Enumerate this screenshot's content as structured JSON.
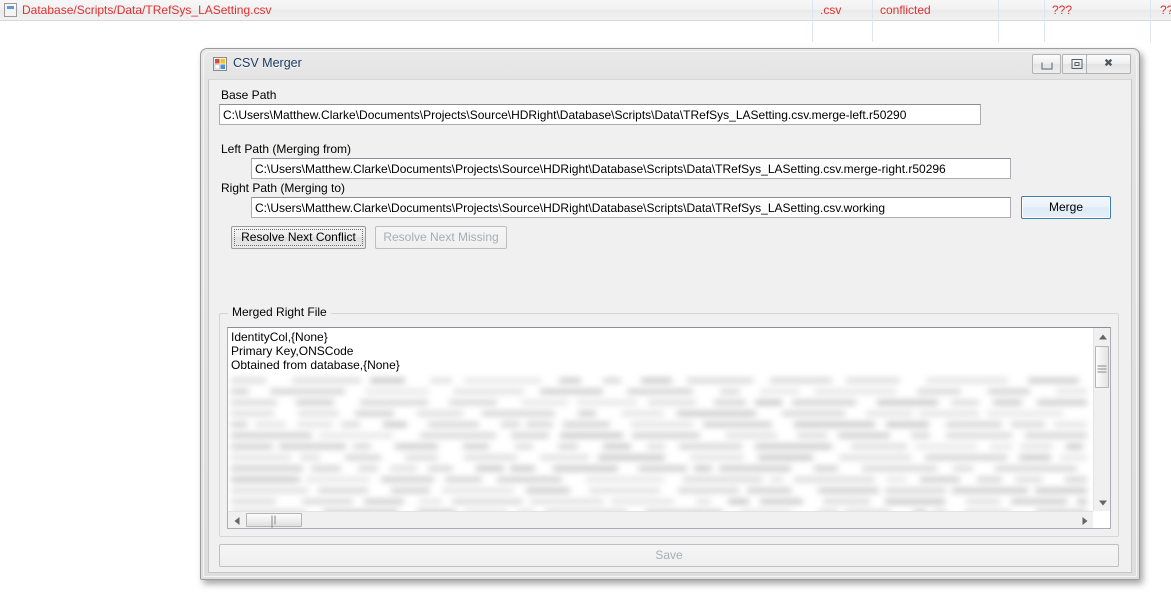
{
  "backdrop": {
    "row": {
      "icon": "csv-file-icon",
      "path": "Database/Scripts/Data/TRefSys_LASetting.csv",
      "extension": ".csv",
      "status": "conflicted",
      "property_status": "???",
      "lock_status": "??",
      "text_color": "#e03030"
    }
  },
  "window": {
    "title": "CSV Merger",
    "icon": "windows-forms-app-icon",
    "controls": {
      "minimize": "minimize-icon",
      "maximize": "restore-icon",
      "close": "✖"
    }
  },
  "form": {
    "base_path": {
      "label": "Base Path",
      "value": "C:\\Users\\Matthew.Clarke\\Documents\\Projects\\Source\\HDRight\\Database\\Scripts\\Data\\TRefSys_LASetting.csv.merge-left.r50290"
    },
    "left_path": {
      "label": "Left Path (Merging from)",
      "value": "C:\\Users\\Matthew.Clarke\\Documents\\Projects\\Source\\HDRight\\Database\\Scripts\\Data\\TRefSys_LASetting.csv.merge-right.r50296"
    },
    "right_path": {
      "label": "Right Path (Merging to)",
      "value": "C:\\Users\\Matthew.Clarke\\Documents\\Projects\\Source\\HDRight\\Database\\Scripts\\Data\\TRefSys_LASetting.csv.working"
    },
    "merge_button": "Merge",
    "resolve_conflict_button": "Resolve Next Conflict",
    "resolve_missing_button": "Resolve Next Missing",
    "save_button": "Save"
  },
  "merged_group": {
    "title": "Merged Right File",
    "content": "IdentityCol,{None}\nPrimary Key,ONSCode\nObtained from database,{None}",
    "redacted_note": "remaining rows blurred"
  },
  "scrollbars": {
    "vertical_up": "scroll-up-arrow",
    "vertical_down": "scroll-down-arrow",
    "horizontal_left": "scroll-left-arrow",
    "horizontal_right": "scroll-right-arrow"
  },
  "colors": {
    "conflict_red": "#e03030",
    "title_blue": "#17375e",
    "default_button_border": "#3c7fb1"
  }
}
